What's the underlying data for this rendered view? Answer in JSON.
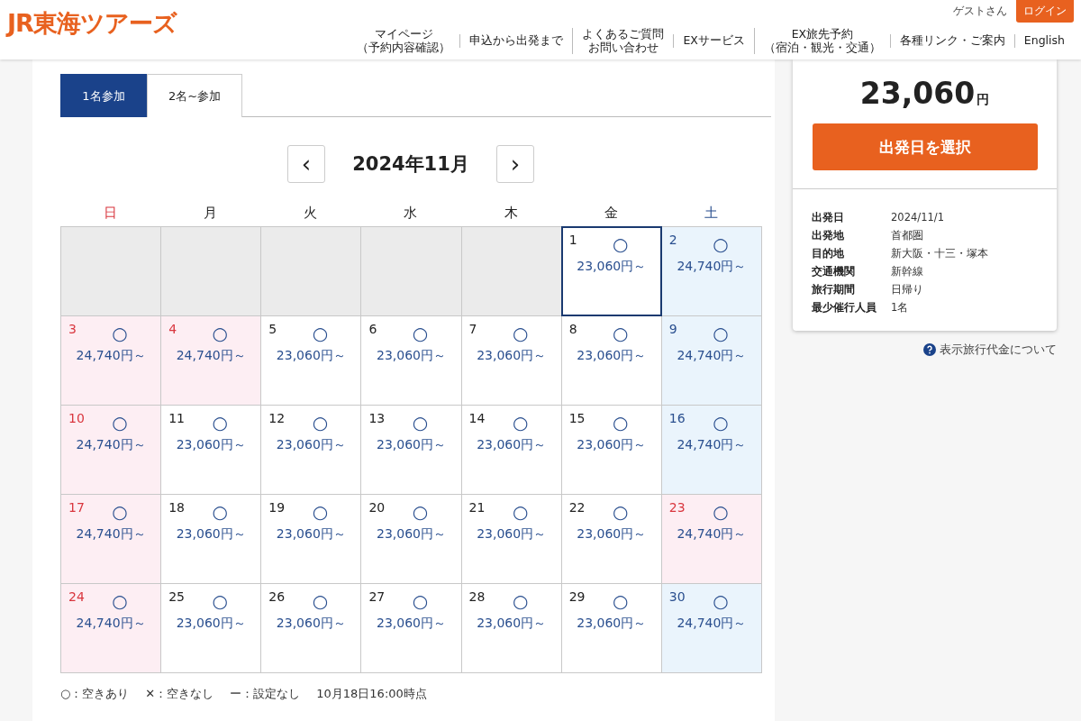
{
  "header": {
    "logo": "JR東海ツアーズ",
    "user": "ゲストさん",
    "login": "ログイン",
    "nav": [
      {
        "lines": [
          "マイページ",
          "（予約内容確認）"
        ]
      },
      {
        "lines": [
          "申込から出発まで"
        ]
      },
      {
        "lines": [
          "よくあるご質問",
          "お問い合わせ"
        ]
      },
      {
        "lines": [
          "EXサービス"
        ]
      },
      {
        "lines": [
          "EX旅先予約",
          "（宿泊・観光・交通）"
        ]
      },
      {
        "lines": [
          "各種リンク・ご案内"
        ]
      },
      {
        "lines": [
          "English"
        ]
      }
    ]
  },
  "tabs": [
    {
      "label": "1名参加",
      "selected": true
    },
    {
      "label": "2名~参加",
      "selected": false
    }
  ],
  "calendar": {
    "month": "2024年11月",
    "prev": "‹",
    "next": "›",
    "weekdays": [
      {
        "label": "日",
        "kind": "holiday"
      },
      {
        "label": "月",
        "kind": "weekday"
      },
      {
        "label": "火",
        "kind": "weekday"
      },
      {
        "label": "水",
        "kind": "weekday"
      },
      {
        "label": "木",
        "kind": "weekday"
      },
      {
        "label": "金",
        "kind": "weekday"
      },
      {
        "label": "土",
        "kind": "saturday"
      }
    ],
    "cells": [
      {
        "kind": "empty"
      },
      {
        "kind": "empty"
      },
      {
        "kind": "empty"
      },
      {
        "kind": "empty"
      },
      {
        "kind": "empty"
      },
      {
        "kind": "weekday",
        "day": "1",
        "mark": "○",
        "price": "23,060円～",
        "selected": true
      },
      {
        "kind": "saturday",
        "day": "2",
        "mark": "○",
        "price": "24,740円～",
        "selected": false
      },
      {
        "kind": "holiday",
        "day": "3",
        "mark": "○",
        "price": "24,740円～",
        "selected": false
      },
      {
        "kind": "holiday",
        "day": "4",
        "mark": "○",
        "price": "24,740円～",
        "selected": false
      },
      {
        "kind": "weekday",
        "day": "5",
        "mark": "○",
        "price": "23,060円～",
        "selected": false
      },
      {
        "kind": "weekday",
        "day": "6",
        "mark": "○",
        "price": "23,060円～",
        "selected": false
      },
      {
        "kind": "weekday",
        "day": "7",
        "mark": "○",
        "price": "23,060円～",
        "selected": false
      },
      {
        "kind": "weekday",
        "day": "8",
        "mark": "○",
        "price": "23,060円～",
        "selected": false
      },
      {
        "kind": "saturday",
        "day": "9",
        "mark": "○",
        "price": "24,740円～",
        "selected": false
      },
      {
        "kind": "holiday",
        "day": "10",
        "mark": "○",
        "price": "24,740円～",
        "selected": false
      },
      {
        "kind": "weekday",
        "day": "11",
        "mark": "○",
        "price": "23,060円～",
        "selected": false
      },
      {
        "kind": "weekday",
        "day": "12",
        "mark": "○",
        "price": "23,060円～",
        "selected": false
      },
      {
        "kind": "weekday",
        "day": "13",
        "mark": "○",
        "price": "23,060円～",
        "selected": false
      },
      {
        "kind": "weekday",
        "day": "14",
        "mark": "○",
        "price": "23,060円～",
        "selected": false
      },
      {
        "kind": "weekday",
        "day": "15",
        "mark": "○",
        "price": "23,060円～",
        "selected": false
      },
      {
        "kind": "saturday",
        "day": "16",
        "mark": "○",
        "price": "24,740円～",
        "selected": false
      },
      {
        "kind": "holiday",
        "day": "17",
        "mark": "○",
        "price": "24,740円～",
        "selected": false
      },
      {
        "kind": "weekday",
        "day": "18",
        "mark": "○",
        "price": "23,060円～",
        "selected": false
      },
      {
        "kind": "weekday",
        "day": "19",
        "mark": "○",
        "price": "23,060円～",
        "selected": false
      },
      {
        "kind": "weekday",
        "day": "20",
        "mark": "○",
        "price": "23,060円～",
        "selected": false
      },
      {
        "kind": "weekday",
        "day": "21",
        "mark": "○",
        "price": "23,060円～",
        "selected": false
      },
      {
        "kind": "weekday",
        "day": "22",
        "mark": "○",
        "price": "23,060円～",
        "selected": false
      },
      {
        "kind": "holiday",
        "day": "23",
        "mark": "○",
        "price": "24,740円～",
        "selected": false
      },
      {
        "kind": "holiday",
        "day": "24",
        "mark": "○",
        "price": "24,740円～",
        "selected": false
      },
      {
        "kind": "weekday",
        "day": "25",
        "mark": "○",
        "price": "23,060円～",
        "selected": false
      },
      {
        "kind": "weekday",
        "day": "26",
        "mark": "○",
        "price": "23,060円～",
        "selected": false
      },
      {
        "kind": "weekday",
        "day": "27",
        "mark": "○",
        "price": "23,060円～",
        "selected": false
      },
      {
        "kind": "weekday",
        "day": "28",
        "mark": "○",
        "price": "23,060円～",
        "selected": false
      },
      {
        "kind": "weekday",
        "day": "29",
        "mark": "○",
        "price": "23,060円～",
        "selected": false
      },
      {
        "kind": "saturday",
        "day": "30",
        "mark": "○",
        "price": "24,740円～",
        "selected": false
      }
    ],
    "legend": [
      "○：空きあり",
      "✕：空きなし",
      "ー：設定なし",
      "10月18日16:00時点"
    ]
  },
  "summary": {
    "price": "23,060",
    "unit": "円",
    "button": "出発日を選択",
    "details": [
      {
        "label": "出発日",
        "value": "2024/11/1"
      },
      {
        "label": "出発地",
        "value": "首都圏"
      },
      {
        "label": "目的地",
        "value": "新大阪・十三・塚本"
      },
      {
        "label": "交通機関",
        "value": "新幹線"
      },
      {
        "label": "旅行期間",
        "value": "日帰り"
      },
      {
        "label": "最少催行人員",
        "value": "1名"
      }
    ],
    "help": "表示旅行代金について"
  }
}
